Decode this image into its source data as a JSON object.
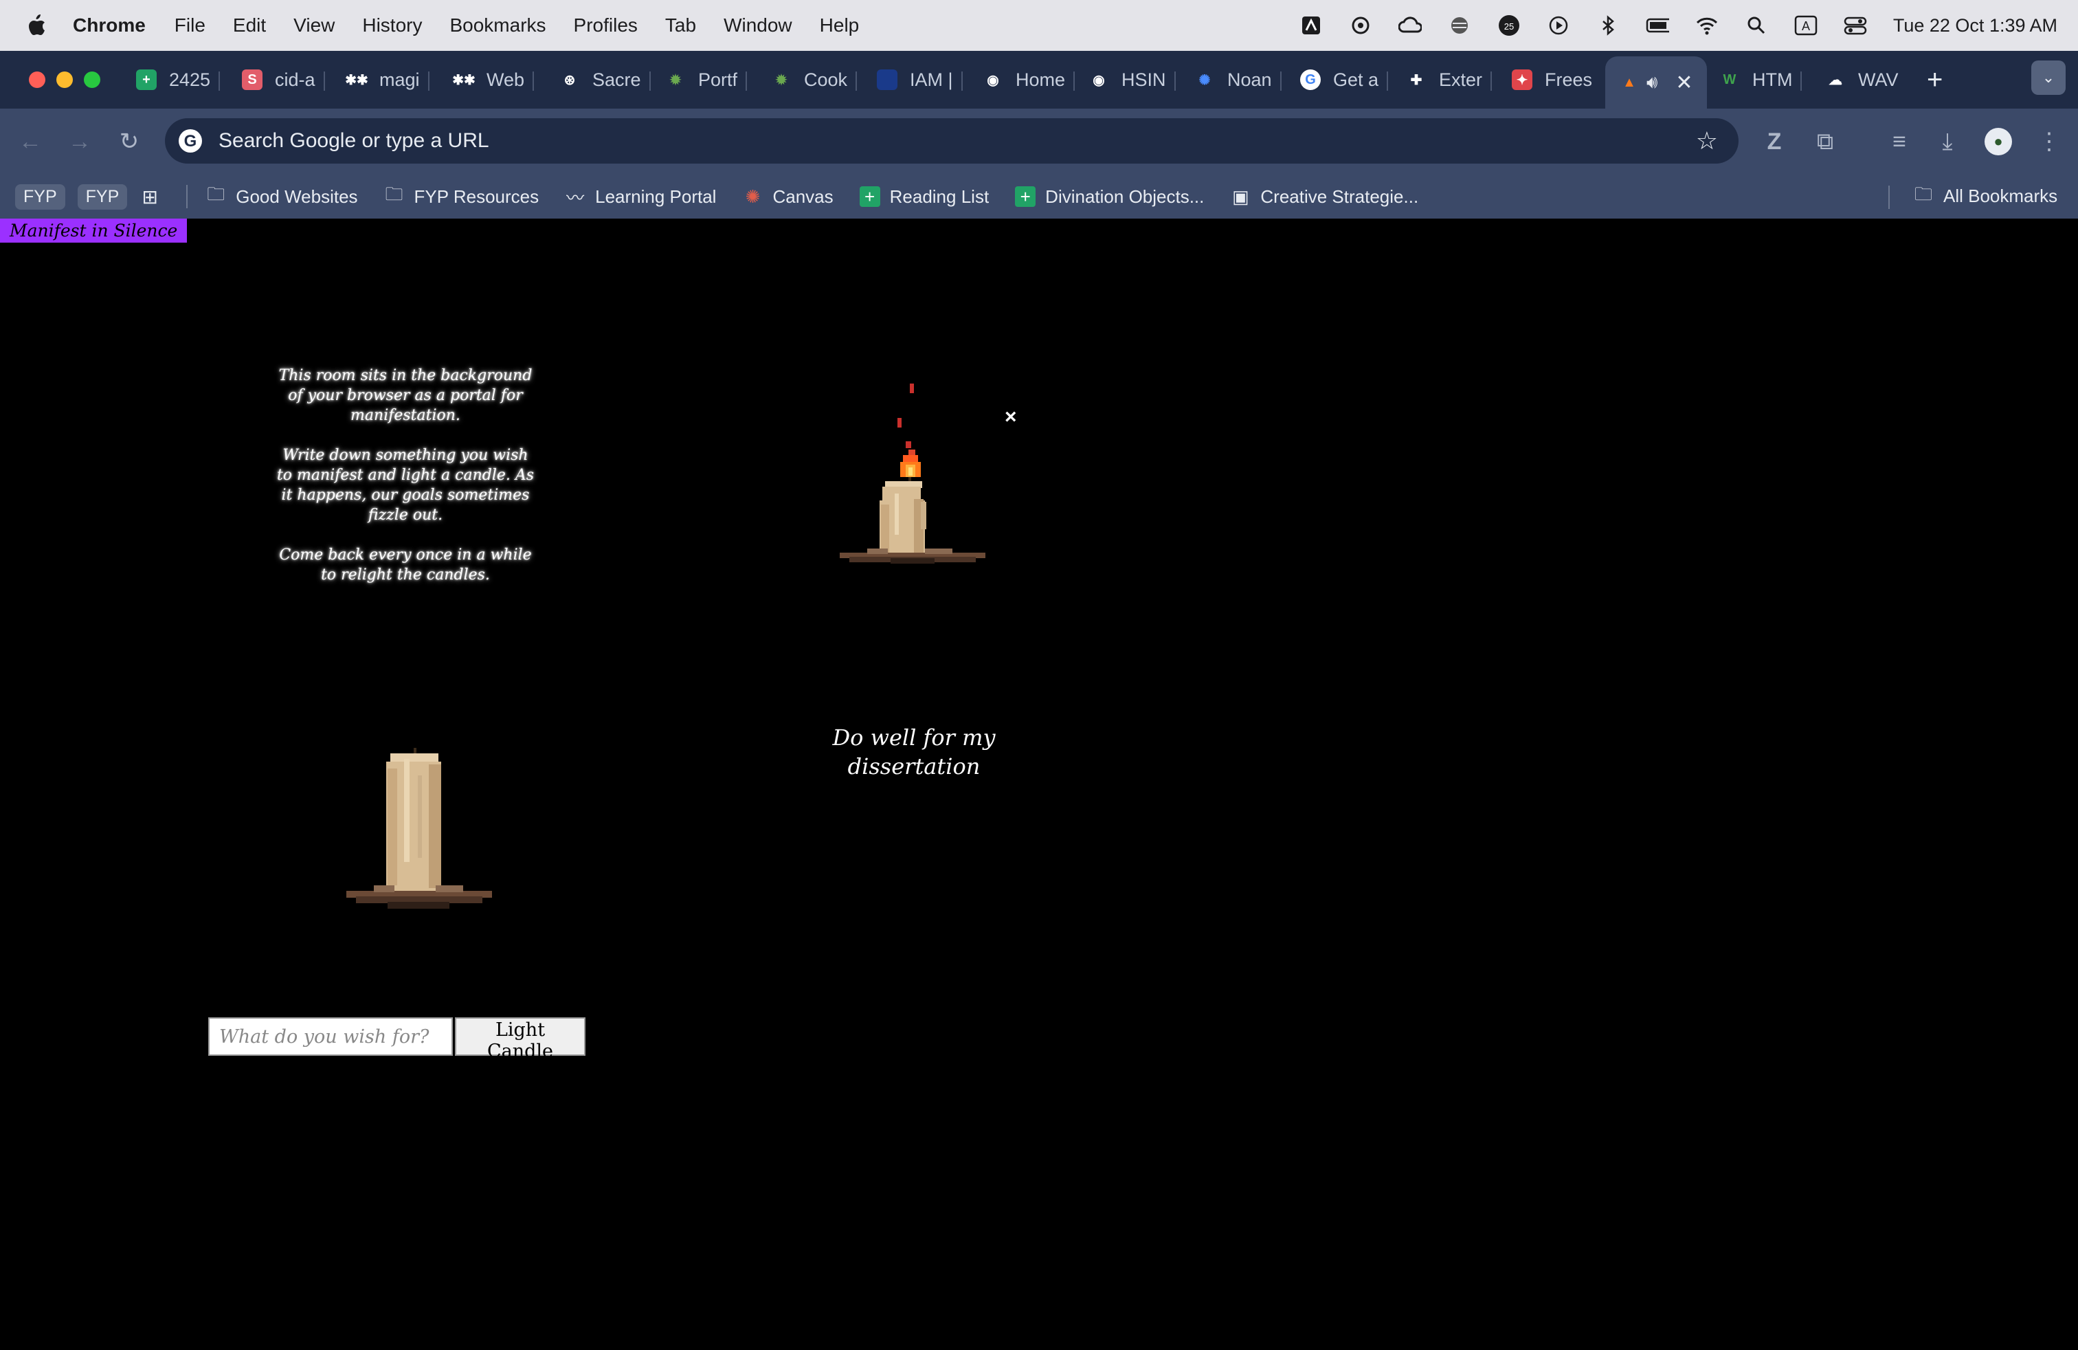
{
  "menubar": {
    "app_name": "Chrome",
    "items": [
      "File",
      "Edit",
      "View",
      "History",
      "Bookmarks",
      "Profiles",
      "Tab",
      "Window",
      "Help"
    ],
    "clock": "Tue 22 Oct  1:39 AM"
  },
  "tabs": [
    {
      "label": "2425",
      "icon": "sheets-icon",
      "color": "#21a366"
    },
    {
      "label": "cid-a",
      "icon": "s-icon",
      "color": "#e25d6a"
    },
    {
      "label": "magi",
      "icon": "asterisk-icon",
      "color": "#c8d0de"
    },
    {
      "label": "Web",
      "icon": "asterisk-icon",
      "color": "#c8d0de"
    },
    {
      "label": "Sacre",
      "icon": "openai-icon",
      "color": "#c8d0de"
    },
    {
      "label": "Portf",
      "icon": "gear-green-icon",
      "color": "#6aa84f"
    },
    {
      "label": "Cook",
      "icon": "gear-green-icon",
      "color": "#6aa84f"
    },
    {
      "label": "IAM |",
      "icon": "shield-icon",
      "color": "#1a3a8a"
    },
    {
      "label": "Home",
      "icon": "eye-icon",
      "color": "#c8d0de"
    },
    {
      "label": "HSIN",
      "icon": "eye-icon",
      "color": "#c8d0de"
    },
    {
      "label": "Noan",
      "icon": "flower-icon",
      "color": "#4a8cff"
    },
    {
      "label": "Get a",
      "icon": "google-icon",
      "color": "#ffffff"
    },
    {
      "label": "Exter",
      "icon": "puzzle-icon",
      "color": "#aeb7c8"
    },
    {
      "label": "Frees",
      "icon": "freesound-icon",
      "color": "#e0454b"
    }
  ],
  "active_tab": {
    "icon": "fire-icon",
    "sound_icon": "speaker-icon"
  },
  "tabs_after": [
    {
      "label": "HTM",
      "icon": "w-icon",
      "color": "#3fa34d"
    },
    {
      "label": "WAV",
      "icon": "cloud-icon",
      "color": "#c8d0de"
    }
  ],
  "omnibox": {
    "text": "Search Google or type a URL"
  },
  "bookmarks": {
    "pills": [
      "FYP",
      "FYP"
    ],
    "items": [
      {
        "label": "Good Websites",
        "icon": "folder-icon"
      },
      {
        "label": "FYP Resources",
        "icon": "folder-icon"
      },
      {
        "label": "Learning Portal",
        "icon": "mustache-icon"
      },
      {
        "label": "Canvas",
        "icon": "canvas-icon"
      },
      {
        "label": "Reading List",
        "icon": "sheets-icon"
      },
      {
        "label": "Divination Objects...",
        "icon": "sheets-icon"
      },
      {
        "label": "Creative Strategie...",
        "icon": "cube-icon"
      }
    ],
    "all_bookmarks": "All Bookmarks"
  },
  "page": {
    "site_label": "Manifest in Silence",
    "intro": [
      "This room sits in the background of your browser as a portal for manifestation.",
      "Write down something you wish to manifest and light a candle. As it happens, our goals sometimes fizzle out.",
      "Come back every once in a while to relight the candles."
    ],
    "wish_text": "Do well for my dissertation",
    "close_glyph": "×",
    "input_placeholder": "What do you wish for?",
    "button_label": "Light Candle"
  },
  "colors": {
    "accent": "#9b30ff",
    "wax": "#d8bd95",
    "flame": "#ff7a1a",
    "chrome_bg": "#1f2b45"
  }
}
